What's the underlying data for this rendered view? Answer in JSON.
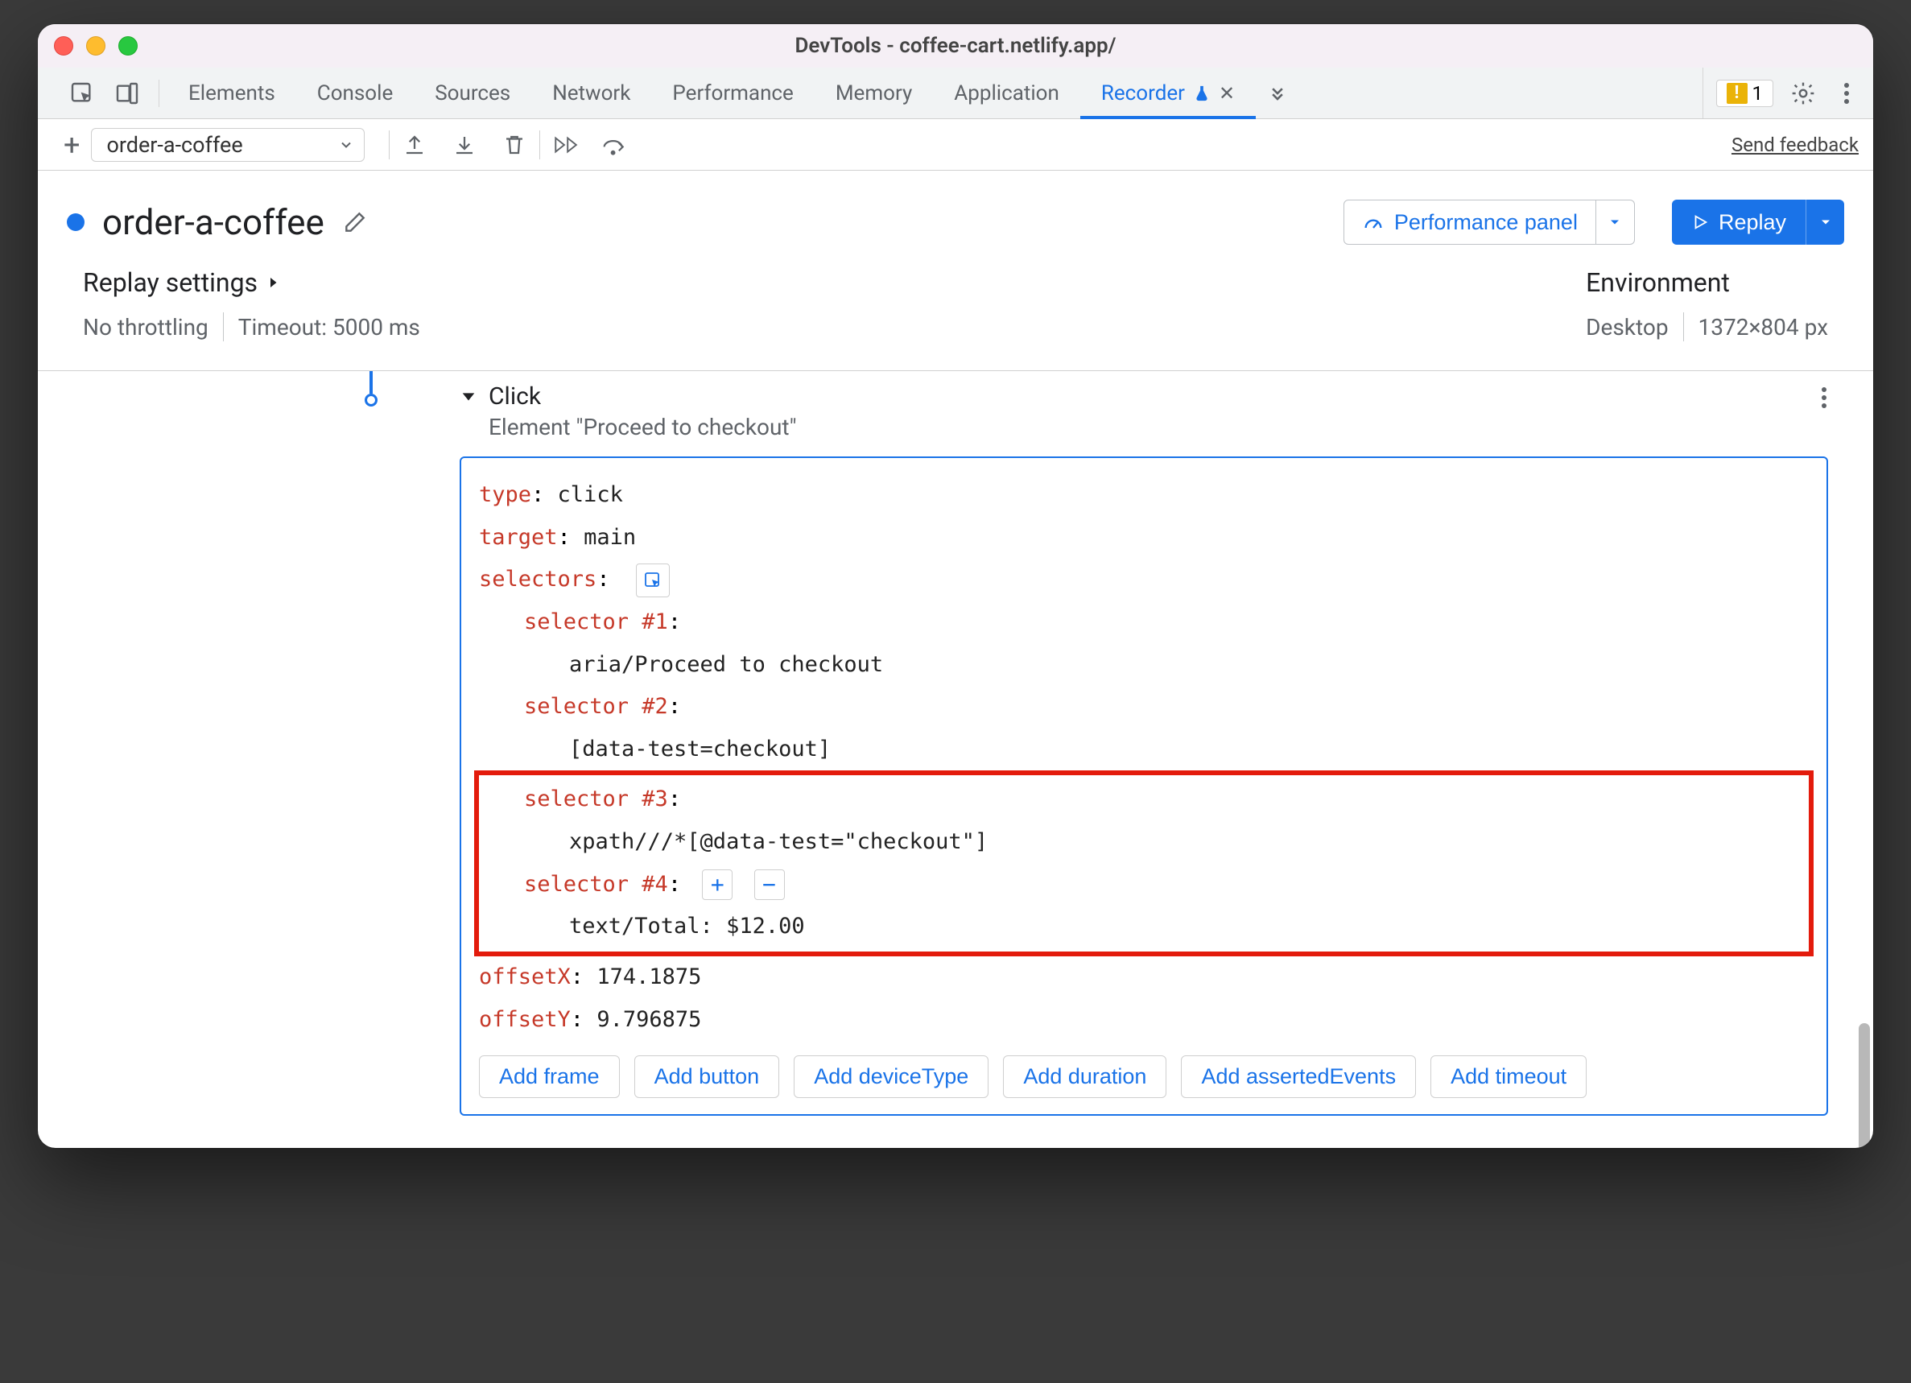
{
  "window": {
    "title": "DevTools - coffee-cart.netlify.app/"
  },
  "tabs": {
    "items": [
      "Elements",
      "Console",
      "Sources",
      "Network",
      "Performance",
      "Memory",
      "Application",
      "Recorder"
    ],
    "active": "Recorder",
    "warn_count": "1"
  },
  "toolbar": {
    "recording_name": "order-a-coffee",
    "feedback": "Send feedback"
  },
  "header": {
    "title": "order-a-coffee",
    "perf_button": "Performance panel",
    "replay_button": "Replay"
  },
  "settings": {
    "replay_heading": "Replay settings",
    "throttle": "No throttling",
    "timeout": "Timeout: 5000 ms",
    "env_heading": "Environment",
    "device": "Desktop",
    "dimensions": "1372×804 px"
  },
  "step": {
    "title": "Click",
    "subtitle": "Element \"Proceed to checkout\"",
    "fields": {
      "type_key": "type",
      "type_val": "click",
      "target_key": "target",
      "target_val": "main",
      "selectors_key": "selectors",
      "sel1_key": "selector #1",
      "sel1_val": "aria/Proceed to checkout",
      "sel2_key": "selector #2",
      "sel2_val": "[data-test=checkout]",
      "sel3_key": "selector #3",
      "sel3_val": "xpath///*[@data-test=\"checkout\"]",
      "sel4_key": "selector #4",
      "sel4_val": "text/Total: $12.00",
      "offsetX_key": "offsetX",
      "offsetX_val": "174.1875",
      "offsetY_key": "offsetY",
      "offsetY_val": "9.796875"
    },
    "add_buttons": [
      "Add frame",
      "Add button",
      "Add deviceType",
      "Add duration",
      "Add assertedEvents",
      "Add timeout"
    ]
  }
}
